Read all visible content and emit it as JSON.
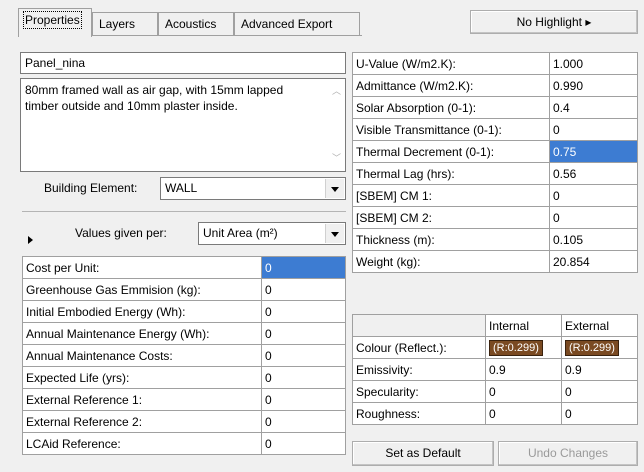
{
  "tabs": [
    {
      "label": "Properties",
      "active": true
    },
    {
      "label": "Layers"
    },
    {
      "label": "Acoustics"
    },
    {
      "label": "Advanced Export"
    }
  ],
  "highlight_button": "No Highlight ▸",
  "name_field": "Panel_nina",
  "description": "80mm framed wall as air gap, with 15mm lapped timber outside and 10mm plaster inside.",
  "building_element": {
    "label": "Building Element:",
    "value": "WALL"
  },
  "values_given_per": {
    "label": "Values given per:",
    "value": "Unit Area (m²)"
  },
  "cost_table": [
    {
      "label": "Cost per Unit:",
      "value": "0",
      "selected": true
    },
    {
      "label": "Greenhouse Gas Emmision (kg):",
      "value": "0"
    },
    {
      "label": "Initial Embodied Energy (Wh):",
      "value": "0"
    },
    {
      "label": "Annual Maintenance Energy (Wh):",
      "value": "0"
    },
    {
      "label": "Annual Maintenance Costs:",
      "value": "0"
    },
    {
      "label": "Expected Life (yrs):",
      "value": "0"
    },
    {
      "label": "External Reference 1:",
      "value": "0"
    },
    {
      "label": "External Reference 2:",
      "value": "0"
    },
    {
      "label": "LCAid Reference:",
      "value": "0"
    }
  ],
  "thermal_table": [
    {
      "label": "U-Value (W/m2.K):",
      "value": "1.000"
    },
    {
      "label": "Admittance (W/m2.K):",
      "value": "0.990"
    },
    {
      "label": "Solar Absorption (0-1):",
      "value": "0.4"
    },
    {
      "label": "Visible Transmittance (0-1):",
      "value": "0"
    },
    {
      "label": "Thermal Decrement (0-1):",
      "value": "0.75",
      "selected": true
    },
    {
      "label": "Thermal Lag (hrs):",
      "value": "0.56"
    },
    {
      "label": "[SBEM] CM 1:",
      "value": "0"
    },
    {
      "label": "[SBEM] CM 2:",
      "value": "0"
    },
    {
      "label": "Thickness (m):",
      "value": "0.105"
    },
    {
      "label": "Weight (kg):",
      "value": "20.854"
    }
  ],
  "surface_table": {
    "col_internal": "Internal",
    "col_external": "External",
    "rows": [
      {
        "label": "Colour (Reflect.):",
        "internal": "(R:0.299)",
        "external": "(R:0.299)",
        "swatch": "#7a4a22"
      },
      {
        "label": "Emissivity:",
        "internal": "0.9",
        "external": "0.9"
      },
      {
        "label": "Specularity:",
        "internal": "0",
        "external": "0"
      },
      {
        "label": "Roughness:",
        "internal": "0",
        "external": "0"
      }
    ]
  },
  "buttons": {
    "set_default": "Set as Default",
    "undo": "Undo Changes"
  }
}
